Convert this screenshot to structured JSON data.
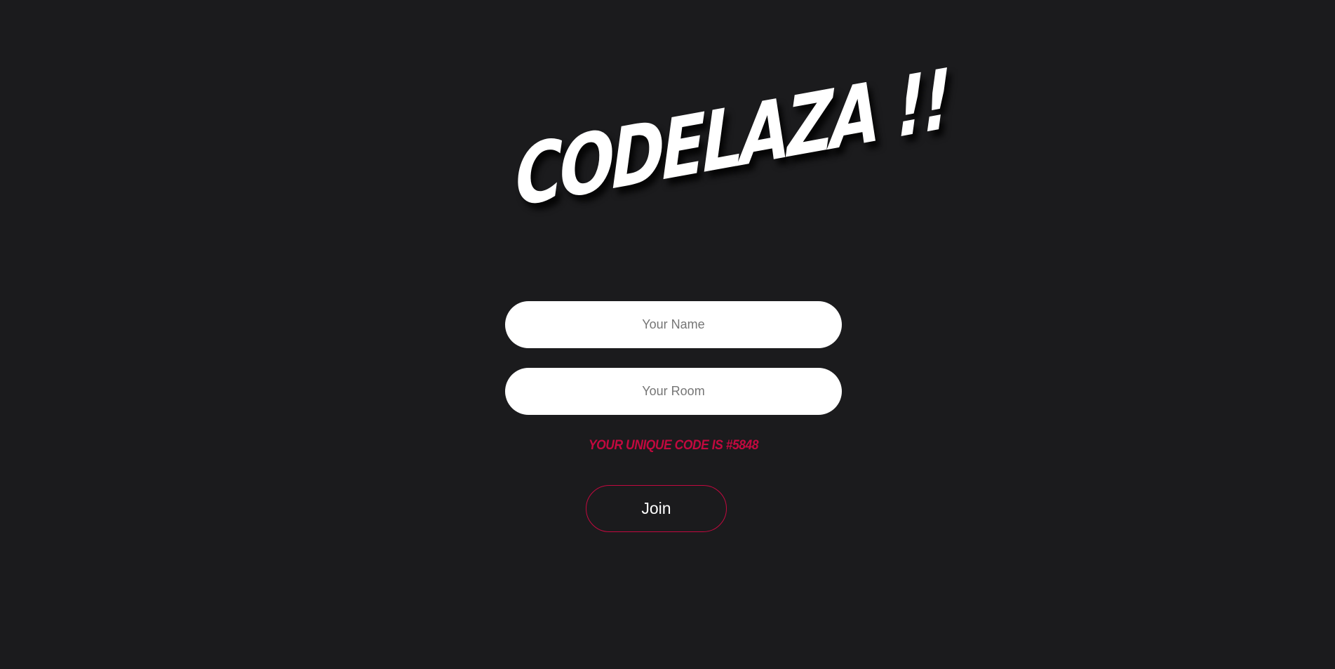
{
  "app": {
    "logo_text": "CODELAZA !!"
  },
  "form": {
    "name_placeholder": "Your Name",
    "room_placeholder": "Your Room",
    "unique_code_text": "YOUR UNIQUE CODE IS #5848",
    "join_label": "Join"
  },
  "colors": {
    "background": "#1b1b1d",
    "accent": "#c2093f",
    "input_background": "#ffffff"
  }
}
